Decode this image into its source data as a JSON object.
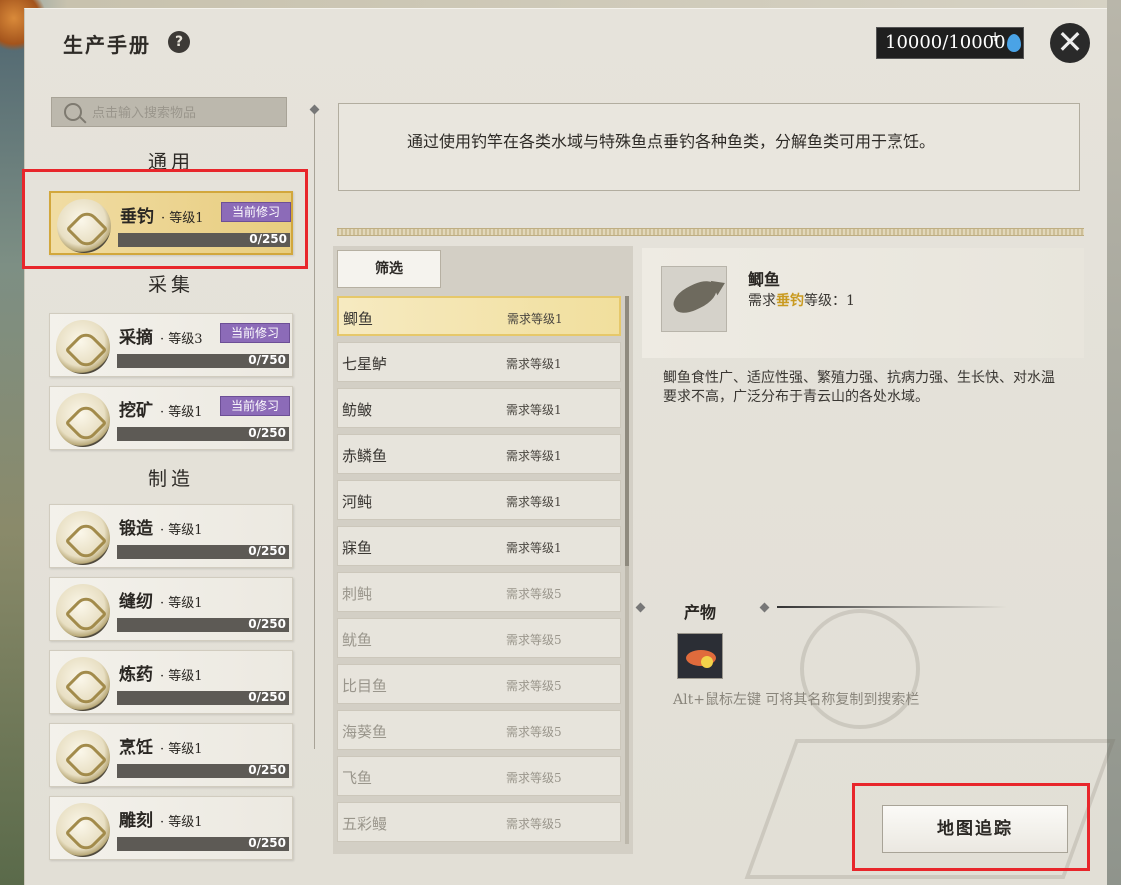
{
  "window": {
    "title": "生产手册",
    "help_symbol": "?"
  },
  "header": {
    "currency": "10000/10000",
    "plus_symbol": "+",
    "close_symbol": "✕"
  },
  "search": {
    "placeholder": "点击输入搜索物品"
  },
  "sections": {
    "general": "通用",
    "gather": "采集",
    "craft": "制造"
  },
  "skills": [
    {
      "name": "垂钓",
      "level": "· 等级1",
      "badge": "当前修习",
      "progress": "0/250",
      "progress_fraction": 0
    },
    {
      "name": "采摘",
      "level": "· 等级3",
      "badge": "当前修习",
      "progress": "0/750",
      "progress_fraction": 0
    },
    {
      "name": "挖矿",
      "level": "· 等级1",
      "badge": "当前修习",
      "progress": "0/250",
      "progress_fraction": 0
    },
    {
      "name": "锻造",
      "level": "· 等级1",
      "progress": "0/250",
      "progress_fraction": 0
    },
    {
      "name": "缝纫",
      "level": "· 等级1",
      "progress": "0/250",
      "progress_fraction": 0
    },
    {
      "name": "炼药",
      "level": "· 等级1",
      "progress": "0/250",
      "progress_fraction": 0
    },
    {
      "name": "烹饪",
      "level": "· 等级1",
      "progress": "0/250",
      "progress_fraction": 0
    },
    {
      "name": "雕刻",
      "level": "· 等级1",
      "progress": "0/250",
      "progress_fraction": 0
    }
  ],
  "description": "通过使用钓竿在各类水域与特殊鱼点垂钓各种鱼类，分解鱼类可用于烹饪。",
  "filter_label": "筛选",
  "items": [
    {
      "name": "鲫鱼",
      "req": "需求等级1"
    },
    {
      "name": "七星鲈",
      "req": "需求等级1"
    },
    {
      "name": "鲂鲏",
      "req": "需求等级1"
    },
    {
      "name": "赤鳞鱼",
      "req": "需求等级1"
    },
    {
      "name": "河鲀",
      "req": "需求等级1"
    },
    {
      "name": "寐鱼",
      "req": "需求等级1"
    },
    {
      "name": "刺鲀",
      "req": "需求等级5"
    },
    {
      "name": "鱿鱼",
      "req": "需求等级5"
    },
    {
      "name": "比目鱼",
      "req": "需求等级5"
    },
    {
      "name": "海葵鱼",
      "req": "需求等级5"
    },
    {
      "name": "飞鱼",
      "req": "需求等级5"
    },
    {
      "name": "五彩鳗",
      "req": "需求等级5"
    }
  ],
  "detail": {
    "name": "鲫鱼",
    "req_prefix": "需求",
    "req_skill": "垂钓",
    "req_suffix": "等级：1",
    "text": "鲫鱼食性广、适应性强、繁殖力强、抗病力强、生长快、对水温要求不高，广泛分布于青云山的各处水域。",
    "output_title": "产物",
    "hint": "Alt+鼠标左键 可将其名称复制到搜索栏"
  },
  "map_button": "地图追踪",
  "colors": {
    "highlight": "#e8262b",
    "badge": "#8c6bb8",
    "selected_gold": "#e8cd7f"
  }
}
